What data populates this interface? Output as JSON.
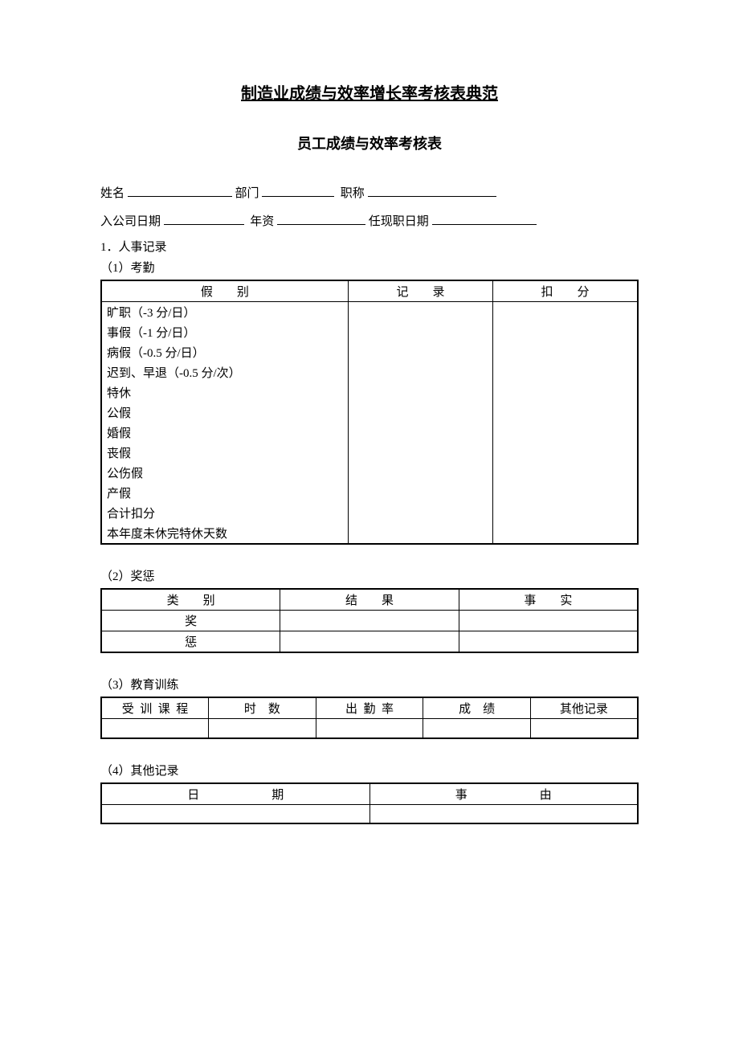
{
  "title_main": "制造业成绩与效率增长率考核表典范",
  "title_sub": "员工成绩与效率考核表",
  "info": {
    "name_label": "姓名",
    "dept_label": "部门",
    "title_label": "职称",
    "join_label": "入公司日期",
    "seniority_label": "年资",
    "current_label": "任现职日期"
  },
  "section1": {
    "heading": "1．人事记录",
    "sub1": {
      "heading": "（1）考勤",
      "headers": {
        "col1": "假别",
        "col2": "记录",
        "col3": "扣分"
      },
      "rows": [
        "旷职（-3 分/日）",
        "事假（-1 分/日）",
        "病假（-0.5 分/日）",
        "迟到、早退（-0.5 分/次）",
        "特休",
        "公假",
        "婚假",
        "丧假",
        "公伤假",
        "产假",
        "合计扣分",
        "本年度未休完特休天数"
      ]
    },
    "sub2": {
      "heading": "（2）奖惩",
      "headers": {
        "col1": "类别",
        "col2": "结果",
        "col3": "事实"
      },
      "rows": [
        "奖",
        "惩"
      ]
    },
    "sub3": {
      "heading": "（3）教育训练",
      "headers": {
        "c1": "受训课程",
        "c2": "时数",
        "c3": "出勤率",
        "c4": "成绩",
        "c5": "其他记录"
      }
    },
    "sub4": {
      "heading": "（4）其他记录",
      "headers": {
        "c1": "日期",
        "c2": "事由"
      }
    }
  }
}
